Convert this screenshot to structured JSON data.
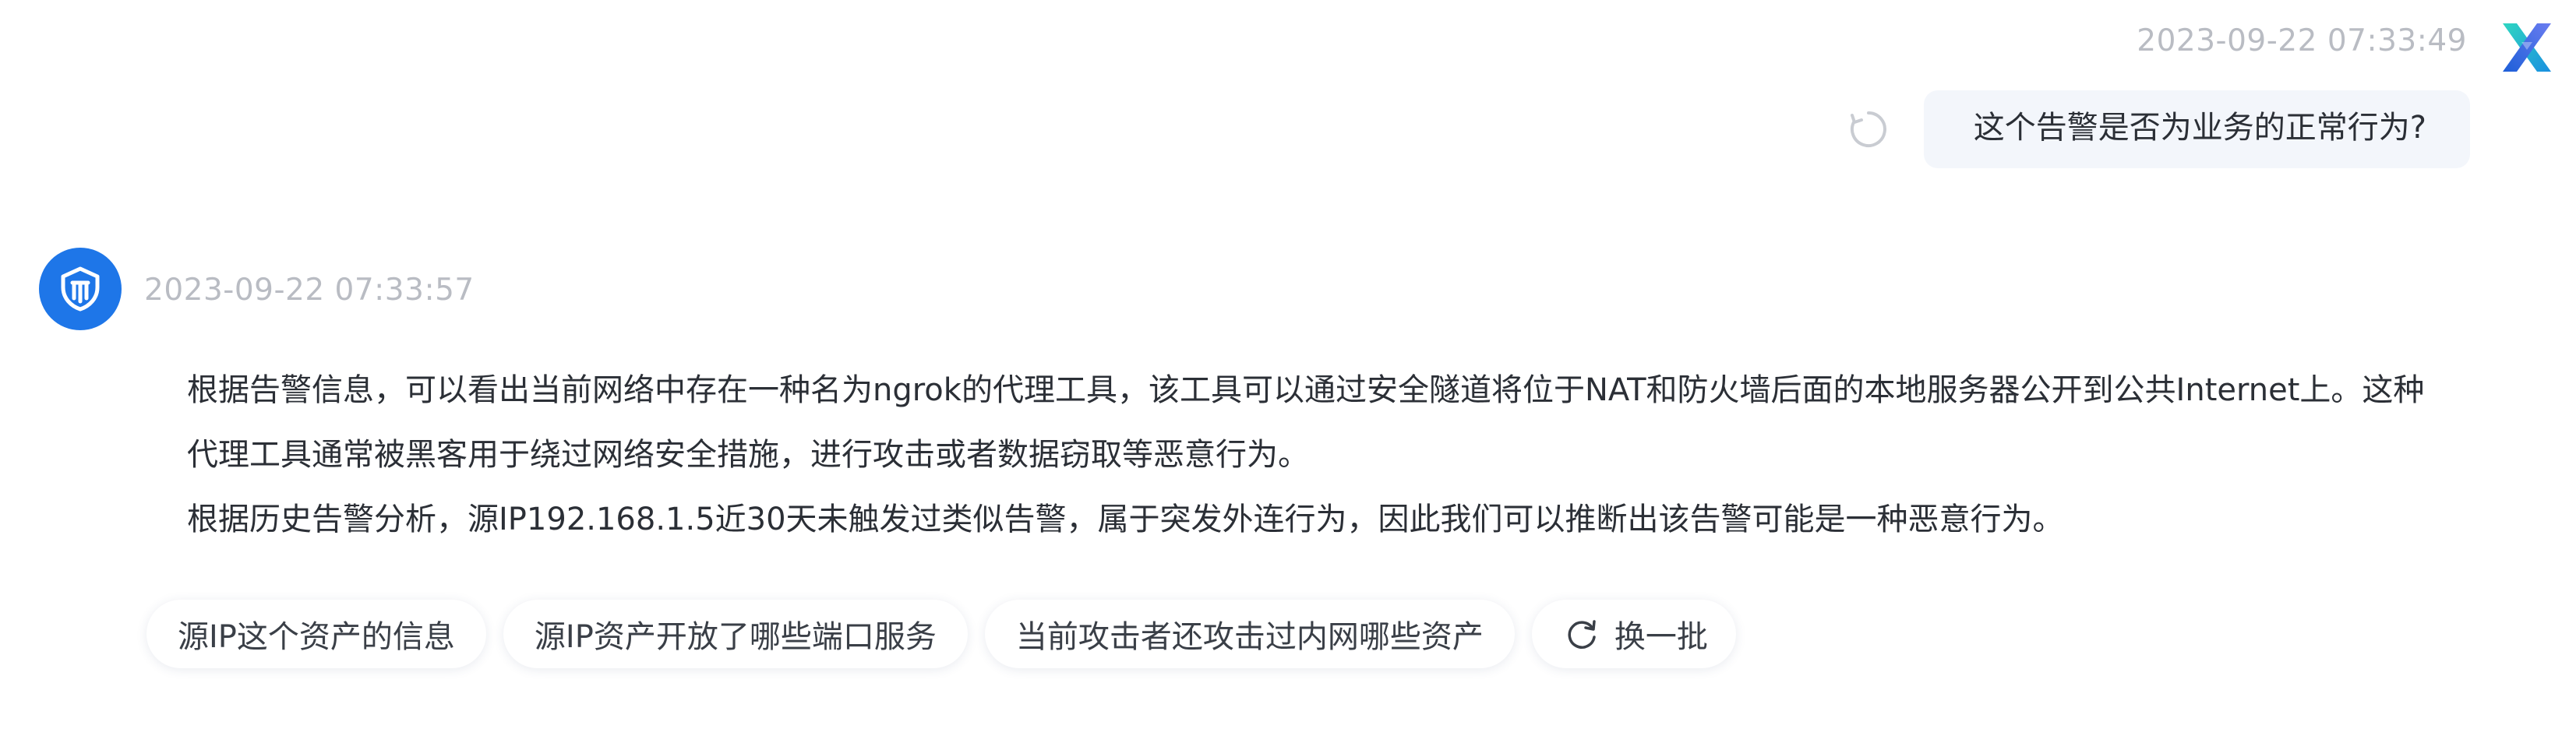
{
  "user_message": {
    "timestamp": "2023-09-22 07:33:49",
    "text": "这个告警是否为业务的正常行为?",
    "avatar_icon": "brand-x-logo-icon",
    "resend_icon": "loading-spinner-icon"
  },
  "bot_message": {
    "timestamp": "2023-09-22 07:33:57",
    "avatar_icon": "shield-bot-logo-icon",
    "avatar_color": "#1e76e8",
    "paragraphs": [
      "根据告警信息，可以看出当前网络中存在一种名为ngrok的代理工具，该工具可以通过安全隧道将位于NAT和防火墙后面的本地服务器公开到公共Internet上。这种代理工具通常被黑客用于绕过网络安全措施，进行攻击或者数据窃取等恶意行为。",
      "根据历史告警分析，源IP192.168.1.5近30天未触发过类似告警，属于突发外连行为，因此我们可以推断出该告警可能是一种恶意行为。"
    ]
  },
  "suggestions": [
    "源IP这个资产的信息",
    "源IP资产开放了哪些端口服务",
    "当前攻击者还攻击过内网哪些资产"
  ],
  "refresh": {
    "label": "换一批",
    "icon": "refresh-icon"
  }
}
